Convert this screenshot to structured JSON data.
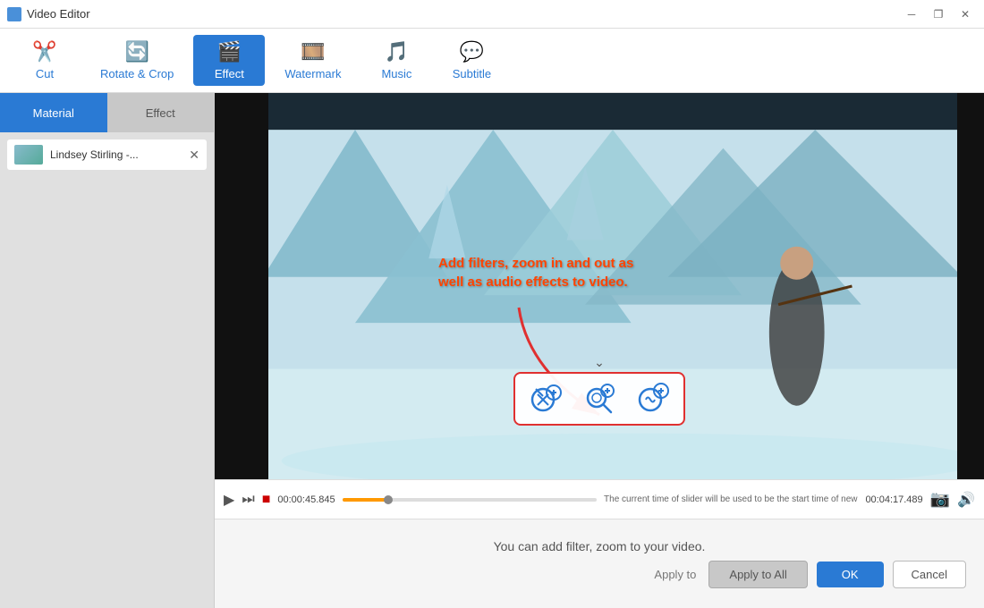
{
  "titleBar": {
    "title": "Video Editor",
    "minimizeLabel": "─",
    "restoreLabel": "❐",
    "closeLabel": "✕"
  },
  "toolbar": {
    "items": [
      {
        "id": "cut",
        "label": "Cut",
        "icon": "✂"
      },
      {
        "id": "rotate",
        "label": "Rotate & Crop",
        "icon": "🔄"
      },
      {
        "id": "effect",
        "label": "Effect",
        "icon": "🎬",
        "active": true
      },
      {
        "id": "watermark",
        "label": "Watermark",
        "icon": "🎞"
      },
      {
        "id": "music",
        "label": "Music",
        "icon": "🎵"
      },
      {
        "id": "subtitle",
        "label": "Subtitle",
        "icon": "💬"
      }
    ]
  },
  "sidebar": {
    "tabs": [
      {
        "id": "material",
        "label": "Material",
        "active": true
      },
      {
        "id": "effect",
        "label": "Effect",
        "active": false
      }
    ],
    "clipLabel": "Lindsey Stirling -..."
  },
  "video": {
    "tooltipText": "Add filters, zoom in and out as\nwell as audio effects to video.",
    "currentTime": "00:00:45.845",
    "endTime": "00:04:17.489",
    "statusText": "The current time of slider will be used to be the start time of new video effect.",
    "floatingButtons": [
      {
        "id": "add-filter",
        "icon": "✨",
        "plus": "+"
      },
      {
        "id": "add-zoom",
        "icon": "🔍",
        "plus": "+"
      },
      {
        "id": "add-audio",
        "icon": "🔊",
        "plus": "+"
      }
    ]
  },
  "bottomPanel": {
    "hint": "You can add filter, zoom to your video.",
    "applyToLabel": "Apply to",
    "applyAllLabel": "Apply to All",
    "okLabel": "OK",
    "cancelLabel": "Cancel"
  }
}
